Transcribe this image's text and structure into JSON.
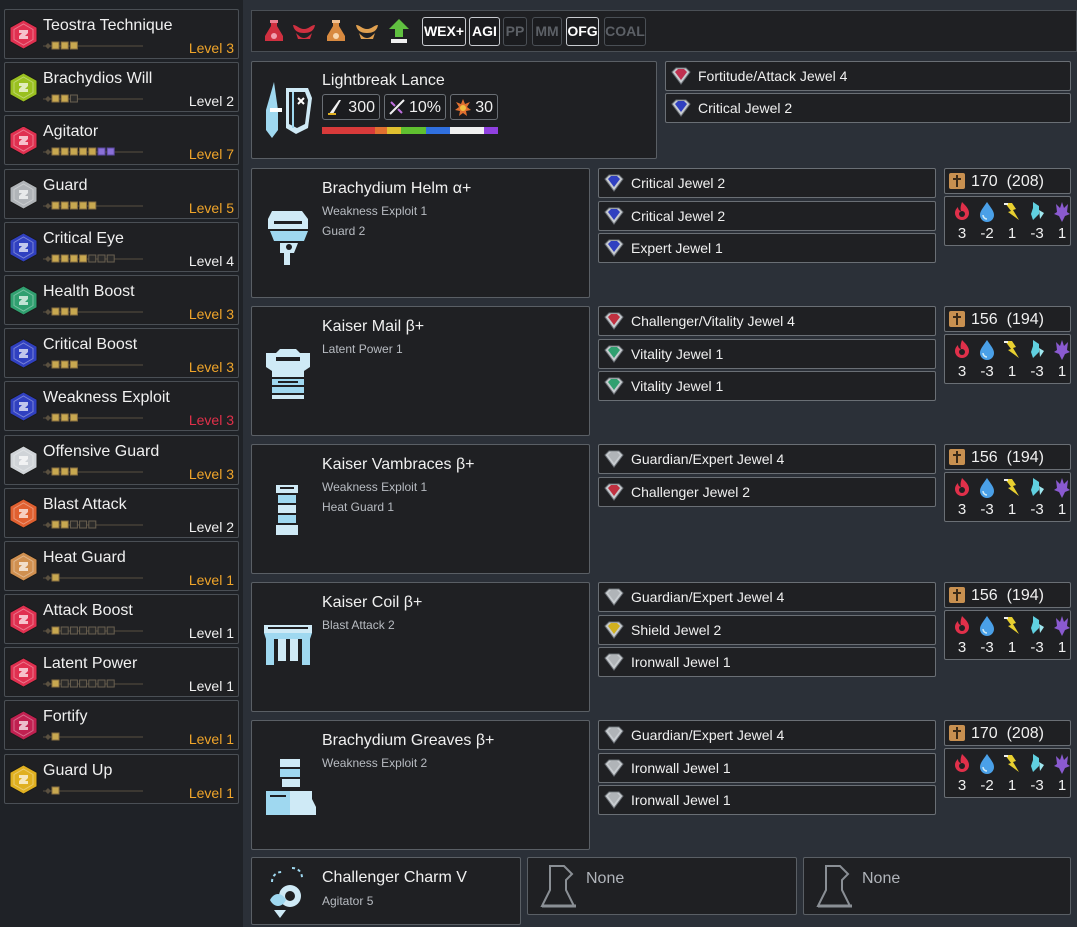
{
  "skills": [
    {
      "name": "Teostra Technique",
      "level": "Level 3",
      "filled": 3,
      "max": 3,
      "overflow": 0,
      "state": "max",
      "color": "#e03050"
    },
    {
      "name": "Brachydios Will",
      "level": "Level 2",
      "filled": 2,
      "max": 3,
      "overflow": 0,
      "state": "norm",
      "color": "#9ac020"
    },
    {
      "name": "Agitator",
      "level": "Level 7",
      "filled": 5,
      "max": 5,
      "overflow": 2,
      "state": "max",
      "color": "#e03050"
    },
    {
      "name": "Guard",
      "level": "Level 5",
      "filled": 5,
      "max": 5,
      "overflow": 0,
      "state": "max",
      "color": "#b0b4b8"
    },
    {
      "name": "Critical Eye",
      "level": "Level 4",
      "filled": 4,
      "max": 7,
      "overflow": 0,
      "state": "norm",
      "color": "#3040c0"
    },
    {
      "name": "Health Boost",
      "level": "Level 3",
      "filled": 3,
      "max": 3,
      "overflow": 0,
      "state": "max",
      "color": "#30a070"
    },
    {
      "name": "Critical Boost",
      "level": "Level 3",
      "filled": 3,
      "max": 3,
      "overflow": 0,
      "state": "max",
      "color": "#3040c0"
    },
    {
      "name": "Weakness Exploit",
      "level": "Level 3",
      "filled": 3,
      "max": 3,
      "overflow": 0,
      "state": "over",
      "color": "#3040c0"
    },
    {
      "name": "Offensive Guard",
      "level": "Level 3",
      "filled": 3,
      "max": 3,
      "overflow": 0,
      "state": "max",
      "color": "#d0d4d8"
    },
    {
      "name": "Blast Attack",
      "level": "Level 2",
      "filled": 2,
      "max": 5,
      "overflow": 0,
      "state": "norm",
      "color": "#e06030"
    },
    {
      "name": "Heat Guard",
      "level": "Level 1",
      "filled": 1,
      "max": 1,
      "overflow": 0,
      "state": "max",
      "color": "#d09050"
    },
    {
      "name": "Attack Boost",
      "level": "Level 1",
      "filled": 1,
      "max": 7,
      "overflow": 0,
      "state": "norm",
      "color": "#e03050"
    },
    {
      "name": "Latent Power",
      "level": "Level 1",
      "filled": 1,
      "max": 7,
      "overflow": 0,
      "state": "norm",
      "color": "#e03050"
    },
    {
      "name": "Fortify",
      "level": "Level 1",
      "filled": 1,
      "max": 1,
      "overflow": 0,
      "state": "max",
      "color": "#c02050"
    },
    {
      "name": "Guard Up",
      "level": "Level 1",
      "filled": 1,
      "max": 1,
      "overflow": 0,
      "state": "max",
      "color": "#e0b020"
    }
  ],
  "topbar": {
    "icons": [
      "red-potion-icon",
      "red-horns-icon",
      "orange-potion-icon",
      "orange-horns-icon",
      "green-arrow-icon"
    ],
    "buttons": [
      {
        "label": "WEX+",
        "active": true
      },
      {
        "label": "AGI",
        "active": true
      },
      {
        "label": "PP",
        "active": false
      },
      {
        "label": "MM",
        "active": false
      },
      {
        "label": "OFG",
        "active": true
      },
      {
        "label": "COAL",
        "active": false
      }
    ]
  },
  "weapon": {
    "name": "Lightbreak Lance",
    "attack": "300",
    "affinity": "10%",
    "element": "30",
    "decorations": [
      {
        "name": "Fortitude/Attack Jewel 4",
        "color": "#c03050"
      },
      {
        "name": "Critical Jewel 2",
        "color": "#3040c0"
      }
    ],
    "sharpness": [
      {
        "color": "#d83a3a",
        "pct": 30
      },
      {
        "color": "#e07030",
        "pct": 7
      },
      {
        "color": "#e0c030",
        "pct": 8
      },
      {
        "color": "#60c030",
        "pct": 14
      },
      {
        "color": "#3070e0",
        "pct": 14
      },
      {
        "color": "#f0f0f0",
        "pct": 19
      },
      {
        "color": "#9040e0",
        "pct": 8
      }
    ]
  },
  "armor": [
    {
      "name": "Brachydium Helm α+",
      "skills": [
        "Weakness Exploit 1",
        "Guard 2"
      ],
      "icon": "helm-icon",
      "defense": "170  (208)",
      "resist": [
        "3",
        "-2",
        "1",
        "-3",
        "1"
      ],
      "decorations": [
        {
          "name": "Critical Jewel 2",
          "color": "#3040c0"
        },
        {
          "name": "Critical Jewel 2",
          "color": "#3040c0"
        },
        {
          "name": "Expert Jewel 1",
          "color": "#3040c0"
        }
      ]
    },
    {
      "name": "Kaiser Mail β+",
      "skills": [
        "Latent Power 1"
      ],
      "icon": "chest-icon",
      "defense": "156  (194)",
      "resist": [
        "3",
        "-3",
        "1",
        "-3",
        "1"
      ],
      "decorations": [
        {
          "name": "Challenger/Vitality Jewel 4",
          "color": "#c03040"
        },
        {
          "name": "Vitality Jewel 1",
          "color": "#30a070"
        },
        {
          "name": "Vitality Jewel 1",
          "color": "#30a070"
        }
      ]
    },
    {
      "name": "Kaiser Vambraces β+",
      "skills": [
        "Weakness Exploit 1",
        "Heat Guard 1"
      ],
      "icon": "arms-icon",
      "defense": "156  (194)",
      "resist": [
        "3",
        "-3",
        "1",
        "-3",
        "1"
      ],
      "decorations": [
        {
          "name": "Guardian/Expert Jewel 4",
          "color": "#b0b4b8"
        },
        {
          "name": "Challenger Jewel 2",
          "color": "#c03040"
        }
      ]
    },
    {
      "name": "Kaiser Coil β+",
      "skills": [
        "Blast Attack 2"
      ],
      "icon": "waist-icon",
      "defense": "156  (194)",
      "resist": [
        "3",
        "-3",
        "1",
        "-3",
        "1"
      ],
      "decorations": [
        {
          "name": "Guardian/Expert Jewel 4",
          "color": "#b0b4b8"
        },
        {
          "name": "Shield Jewel 2",
          "color": "#d0b020"
        },
        {
          "name": "Ironwall Jewel 1",
          "color": "#b0b4b8"
        }
      ]
    },
    {
      "name": "Brachydium Greaves β+",
      "skills": [
        "Weakness Exploit 2"
      ],
      "icon": "legs-icon",
      "defense": "170  (208)",
      "resist": [
        "3",
        "-2",
        "1",
        "-3",
        "1"
      ],
      "decorations": [
        {
          "name": "Guardian/Expert Jewel 4",
          "color": "#b0b4b8"
        },
        {
          "name": "Ironwall Jewel 1",
          "color": "#b0b4b8"
        },
        {
          "name": "Ironwall Jewel 1",
          "color": "#b0b4b8"
        }
      ]
    }
  ],
  "charm": {
    "name": "Challenger Charm V",
    "skill": "Agitator 5"
  },
  "empty_slots": [
    "None",
    "None"
  ],
  "colors": {
    "fire": "#e0304a",
    "water": "#4aa0e8",
    "thunder": "#e8d030",
    "ice": "#60d0e0",
    "dragon": "#8a5ad0",
    "pip": "#c8a850",
    "pip_overflow": "#8a70d8",
    "defense": "#c89050"
  }
}
